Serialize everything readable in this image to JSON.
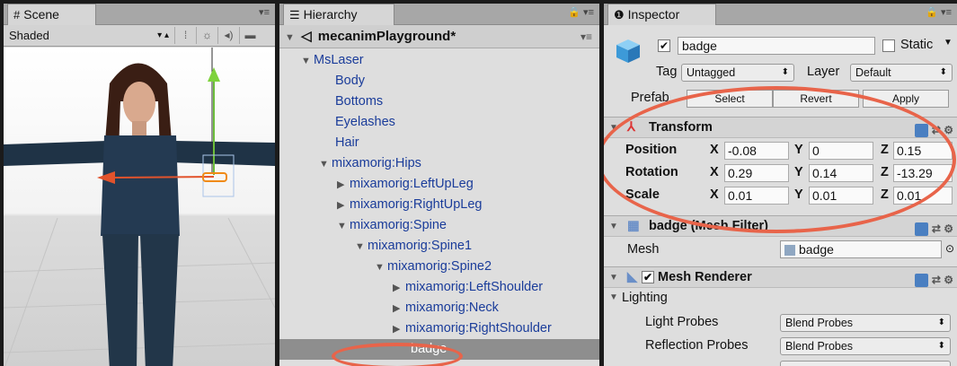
{
  "scene": {
    "tab_label": "Scene",
    "tab_icon": "#",
    "shading": "Shaded",
    "toolbar_icons": [
      "2d-toggle-icon",
      "light-icon",
      "audio-icon",
      "image-effects-icon"
    ]
  },
  "hierarchy": {
    "tab_label": "Hierarchy",
    "root": "mecanimPlayground*",
    "items": [
      {
        "label": "MsLaser",
        "expanded": true
      },
      {
        "label": "Body"
      },
      {
        "label": "Bottoms"
      },
      {
        "label": "Eyelashes"
      },
      {
        "label": "Hair"
      },
      {
        "label": "mixamorig:Hips",
        "expanded": true
      },
      {
        "label": "mixamorig:LeftUpLeg",
        "expanded": false
      },
      {
        "label": "mixamorig:RightUpLeg",
        "expanded": false
      },
      {
        "label": "mixamorig:Spine",
        "expanded": true
      },
      {
        "label": "mixamorig:Spine1",
        "expanded": true
      },
      {
        "label": "mixamorig:Spine2",
        "expanded": true
      },
      {
        "label": "mixamorig:LeftShoulder",
        "expanded": false
      },
      {
        "label": "mixamorig:Neck",
        "expanded": false
      },
      {
        "label": "mixamorig:RightShoulder",
        "expanded": false
      },
      {
        "label": "badge",
        "selected": true
      }
    ]
  },
  "inspector": {
    "tab_label": "Inspector",
    "object_name": "badge",
    "object_active": true,
    "static_label": "Static",
    "tag_label": "Tag",
    "tag_value": "Untagged",
    "layer_label": "Layer",
    "layer_value": "Default",
    "prefab_label": "Prefab",
    "prefab_buttons": [
      "Select",
      "Revert",
      "Apply"
    ],
    "transform": {
      "title": "Transform",
      "position_label": "Position",
      "rotation_label": "Rotation",
      "scale_label": "Scale",
      "position": {
        "x": "-0.08",
        "y": "0",
        "z": "0.15"
      },
      "rotation": {
        "x": "0.29",
        "y": "0.14",
        "z": "-13.29"
      },
      "scale": {
        "x": "0.01",
        "y": "0.01",
        "z": "0.01"
      }
    },
    "mesh_filter": {
      "title": "badge (Mesh Filter)",
      "mesh_label": "Mesh",
      "mesh_value": "badge"
    },
    "mesh_renderer": {
      "title": "Mesh Renderer",
      "enabled": true,
      "lighting_label": "Lighting",
      "light_probes_label": "Light Probes",
      "light_probes_value": "Blend Probes",
      "reflection_probes_label": "Reflection Probes",
      "reflection_probes_value": "Blend Probes"
    }
  },
  "colors": {
    "annotation": "#e8644a",
    "link_text": "#1a3c9a",
    "selection": "#8e8e8e"
  }
}
